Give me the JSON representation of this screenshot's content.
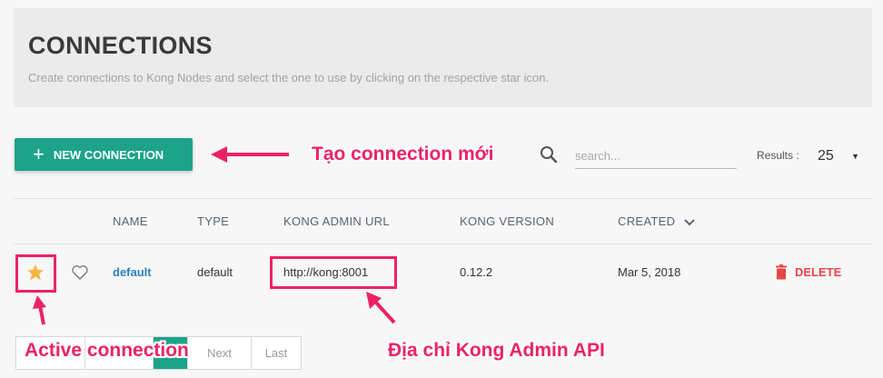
{
  "header": {
    "title": "CONNECTIONS",
    "subtitle": "Create connections to Kong Nodes and select the one to use by clicking on the respective star icon."
  },
  "toolbar": {
    "new_button_label": "NEW CONNECTION",
    "new_button_icon": "plus-icon",
    "search_placeholder": "search...",
    "search_value": "",
    "results_label": "Results :",
    "results_value": "25"
  },
  "table": {
    "columns": [
      "NAME",
      "TYPE",
      "KONG ADMIN URL",
      "KONG VERSION",
      "CREATED"
    ],
    "sort_column": "CREATED",
    "rows": [
      {
        "name": "default",
        "type": "default",
        "kong_admin_url": "http://kong:8001",
        "kong_version": "0.12.2",
        "created": "Mar 5, 2018",
        "active": true,
        "delete_label": "DELETE"
      }
    ]
  },
  "pagination": {
    "current": "1",
    "next_label": "Next",
    "last_label": "Last"
  },
  "annotations": {
    "new_connection": "Tạo connection mới",
    "active_connection": "Active connection",
    "admin_api": "Địa chỉ Kong Admin API"
  },
  "colors": {
    "accent": "#1ca38a",
    "annotation": "#ec2267",
    "star": "#f5b642",
    "delete": "#e84545",
    "link": "#2a7fbf"
  }
}
